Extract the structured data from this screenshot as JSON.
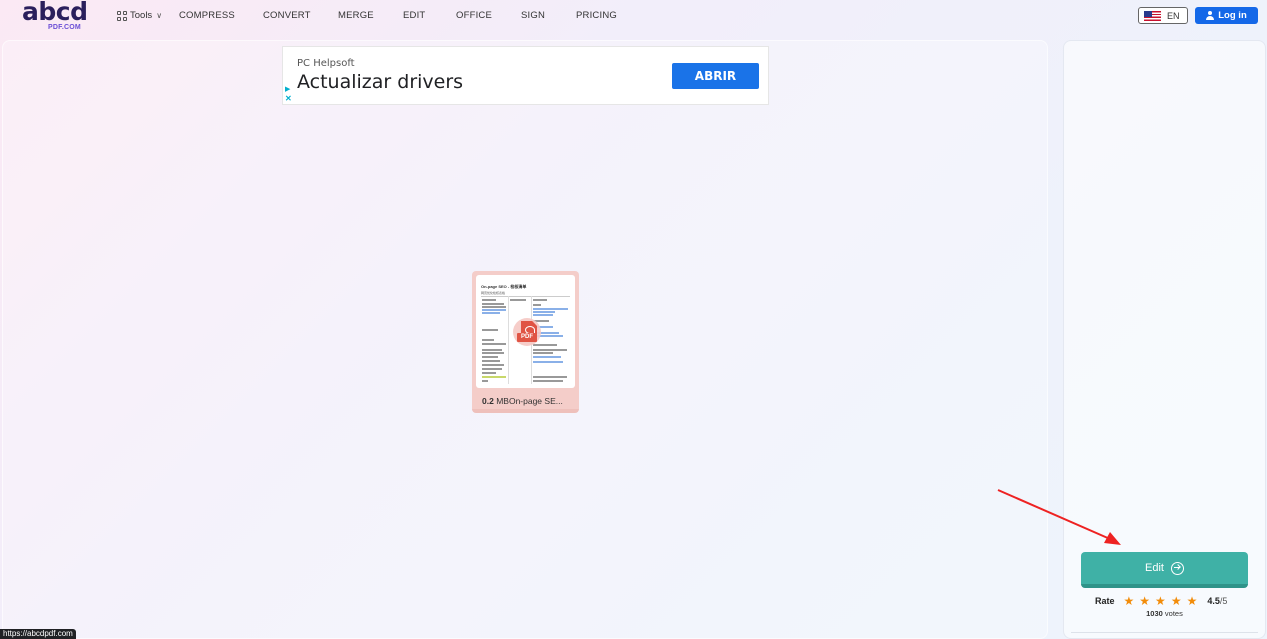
{
  "header": {
    "logo_main": "abcd",
    "logo_sub": "PDF.COM",
    "tools_label": "Tools",
    "nav": [
      "COMPRESS",
      "CONVERT",
      "MERGE",
      "EDIT",
      "OFFICE",
      "SIGN",
      "PRICING"
    ],
    "language": "EN",
    "login_label": "Log in"
  },
  "ad": {
    "advertiser": "PC Helpsoft",
    "headline": "Actualizar drivers",
    "cta": "ABRIR"
  },
  "file": {
    "size": "0.2",
    "name": "MBOn-page SE...",
    "thumb_title": "On-page SEO - 检核清单",
    "thumb_subtitle": "网页优化检核表格",
    "pdf_badge": "PDF"
  },
  "sidebar": {
    "edit_label": "Edit",
    "rate_label": "Rate",
    "rating_value": 4.5,
    "score": "4.5",
    "score_max": "/5",
    "votes_count": "1030",
    "votes_label": "votes",
    "star_color": "#f28c0a",
    "edit_color": "#3fb1a6"
  },
  "status_bar": {
    "url": "https://abcdpdf.com"
  },
  "colors": {
    "login_button": "#1468e8",
    "ad_cta": "#1a73e8",
    "arrow": "#ee2222"
  }
}
